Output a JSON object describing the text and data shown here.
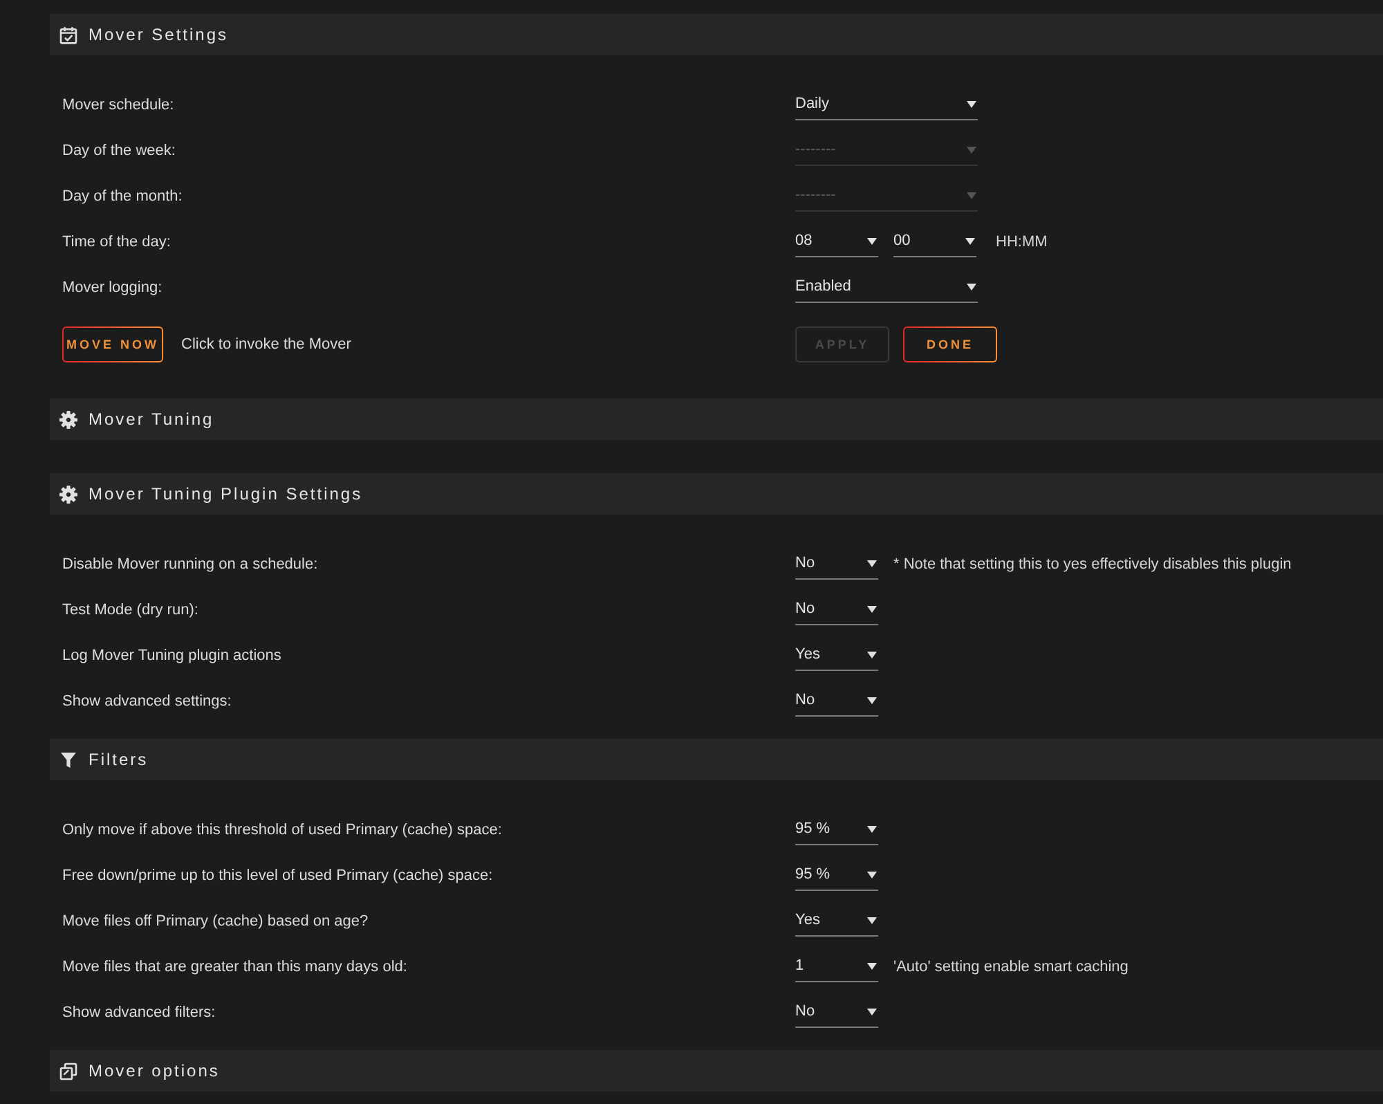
{
  "sections": [
    {
      "title": "Mover Settings",
      "kind": "schedule",
      "rows": [
        {
          "kind": "select",
          "label": "Mover schedule:",
          "select": {
            "value": "Daily",
            "disabled": false
          }
        },
        {
          "kind": "select",
          "label": "Day of the week:",
          "select": {
            "value": "--------",
            "disabled": true
          }
        },
        {
          "kind": "select",
          "label": "Day of the month:",
          "select": {
            "value": "--------",
            "disabled": true
          }
        },
        {
          "kind": "time",
          "label": "Time of the day:",
          "selects": [
            {
              "value": "08",
              "disabled": false
            },
            {
              "value": "00",
              "disabled": false
            }
          ],
          "unit": "HH:MM"
        },
        {
          "kind": "select",
          "label": "Mover logging:",
          "select": {
            "value": "Enabled",
            "disabled": false
          }
        },
        {
          "kind": "actions",
          "button": {
            "label": "MOVE NOW",
            "disabled": false
          },
          "text": "Click to invoke the Mover",
          "buttons": [
            {
              "label": "APPLY",
              "disabled": true
            },
            {
              "label": "DONE",
              "disabled": false
            }
          ]
        }
      ]
    },
    {
      "title": "Mover Tuning",
      "kind": "tuning"
    },
    {
      "title": "Mover Tuning Plugin Settings",
      "kind": "tuning",
      "rows": [
        {
          "kind": "select",
          "label": "Disable Mover running on a schedule:",
          "select": {
            "value": "No",
            "disabled": false
          },
          "note": "* Note that setting this to yes effectively disables this plugin"
        },
        {
          "kind": "select",
          "label": "Test Mode (dry run):",
          "select": {
            "value": "No",
            "disabled": false
          }
        },
        {
          "kind": "select",
          "label": "Log Mover Tuning plugin actions",
          "select": {
            "value": "Yes",
            "disabled": false
          }
        },
        {
          "kind": "select",
          "label": "Show advanced settings:",
          "select": {
            "value": "No",
            "disabled": false
          }
        }
      ]
    },
    {
      "title": "Filters",
      "kind": "filter",
      "rows": [
        {
          "kind": "select",
          "label": "Only move if above this threshold of used Primary (cache) space:",
          "select": {
            "value": "95 %",
            "disabled": false
          }
        },
        {
          "kind": "select",
          "label": "Free down/prime up to this level of used Primary (cache) space:",
          "select": {
            "value": "95 %",
            "disabled": false
          }
        },
        {
          "kind": "select",
          "label": "Move files off Primary (cache) based on age?",
          "select": {
            "value": "Yes",
            "disabled": false
          }
        },
        {
          "kind": "select",
          "label": "Move files that are greater than this many days old:",
          "select": {
            "value": "1",
            "disabled": false
          },
          "note": "'Auto' setting enable smart caching"
        },
        {
          "kind": "select",
          "label": "Show advanced filters:",
          "select": {
            "value": "No",
            "disabled": false
          }
        }
      ]
    },
    {
      "title": "Mover options",
      "kind": "options"
    }
  ]
}
